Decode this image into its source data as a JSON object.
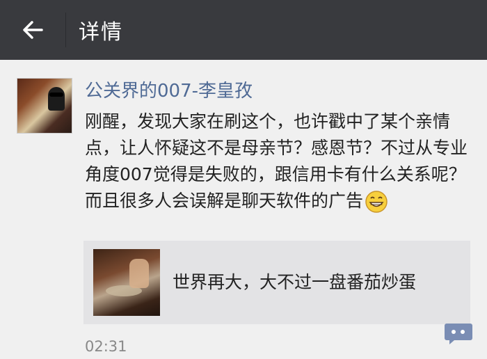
{
  "header": {
    "title": "详情"
  },
  "post": {
    "author": "公关界的007-李皇孜",
    "text": "刚醒，发现大家在刷这个，也许戳中了某个亲情点，让人怀疑这不是母亲节？感恩节？不过从专业角度007觉得是失败的，跟信用卡有什么关系呢？而且很多人会误解是聊天软件的广告",
    "link": {
      "title": "世界再大，大不过一盘番茄炒蛋"
    },
    "time": "02:31"
  },
  "colors": {
    "header_bg": "#393a3e",
    "nickname": "#4f6a95",
    "card_bg": "#e3e3e5",
    "comment_btn": "#7a8db4"
  }
}
